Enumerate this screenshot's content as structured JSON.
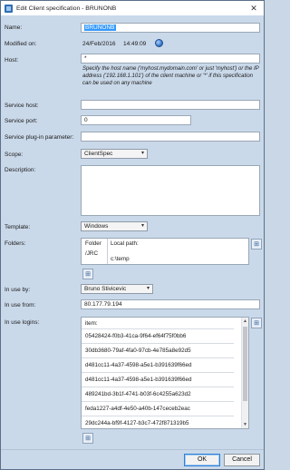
{
  "window": {
    "title": "Edit Client specification - BRUNONB",
    "close_symbol": "✕"
  },
  "form": {
    "name": {
      "label": "Name:",
      "value": "BRUNONB"
    },
    "modified": {
      "label": "Modified on:",
      "date": "24/Feb/2016",
      "time": "14:49:09"
    },
    "host": {
      "label": "Host:",
      "value": "*",
      "hint": "Specify the host name ('myhost.mydomain.com' or just 'myhost') or the IP address ('192.168.1.101') of the client machine or '*' if this specification can be used on any machine"
    },
    "service_host": {
      "label": "Service host:",
      "value": ""
    },
    "service_port": {
      "label": "Service port:",
      "value": "0"
    },
    "service_plugin": {
      "label": "Service plug-in parameter:",
      "value": ""
    },
    "scope": {
      "label": "Scope:",
      "value": "ClientSpec"
    },
    "description": {
      "label": "Description:",
      "value": ""
    },
    "template": {
      "label": "Template:",
      "value": "Windows"
    },
    "folders": {
      "label": "Folders:",
      "columns": [
        "Folder",
        "Local path:"
      ],
      "rows": [
        {
          "folder": "/JRC",
          "local_path": "c:\\temp"
        }
      ]
    },
    "in_use_by": {
      "label": "In use by:",
      "value": "Bruno Stivicevic"
    },
    "in_use_from": {
      "label": "In use from:",
      "value": "80.177.79.194"
    },
    "in_use_logins": {
      "label": "In use logins:",
      "column": "item:",
      "items": [
        "05428424-f0b3-41ca-9f64-ef64f75f0bb6",
        "30db3680-79af-4fa0-97cb-4e785a8e92d5",
        "d481cc11-4a37-4598-a5e1-b391639f66ed",
        "d481cc11-4a37-4598-a5e1-b391639f66ed",
        "489241bd-3b1f-4741-b03f-6c4255a623d2",
        "feda1227-a4df-4e50-a40b-147ceceb2eac",
        "29dc244a-bf9f-4127-b3c7-472f871319b5"
      ]
    }
  },
  "buttons": {
    "ok": "OK",
    "cancel": "Cancel"
  },
  "icons": {
    "app": "document-icon",
    "info": "info-icon",
    "add_folder": "add-row-icon",
    "add_login": "add-row-icon"
  },
  "colors": {
    "content_bg": "#cad9ea",
    "selection": "#3399ff",
    "default_button_border": "#2f7fd3"
  }
}
